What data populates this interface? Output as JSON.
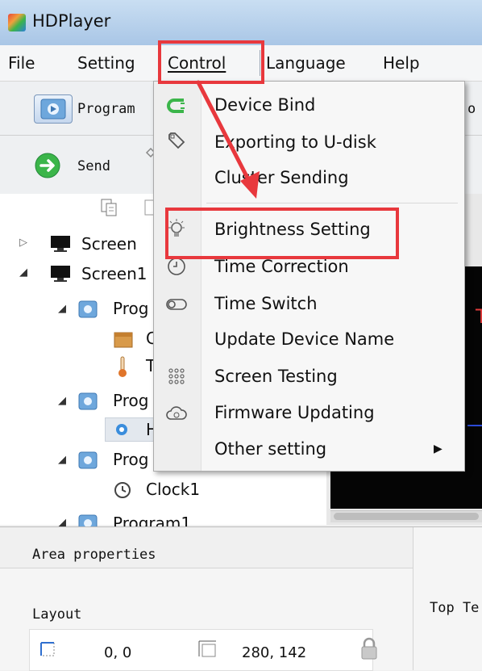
{
  "window": {
    "title": "HDPlayer"
  },
  "menubar": {
    "file": "File",
    "setting": "Setting",
    "control": "Control",
    "language": "Language",
    "help": "Help"
  },
  "toolbar": {
    "program": "Program",
    "send": "Send",
    "partial_right": "o"
  },
  "tree": {
    "screen": "Screen",
    "screen1": "Screen1",
    "prog_a": "Prog",
    "child_a1": "C",
    "child_a2": "T",
    "prog_b": "Prog",
    "child_b1": "H",
    "prog_c": "Prog",
    "clock": "Clock1",
    "program1": "Program1"
  },
  "preview": {
    "text_partial": "T"
  },
  "properties": {
    "header": "Area properties",
    "layout_label": "Layout",
    "position": "0, 0",
    "size": "280, 142",
    "right_label": "Top Te"
  },
  "control_menu": {
    "items": [
      {
        "label": "Device Bind",
        "icon": "magnet-icon"
      },
      {
        "label": "Exporting to U-disk",
        "icon": "usb-icon"
      },
      {
        "label": "Cluster Sending",
        "icon": "none"
      },
      {
        "label": "Brightness Setting",
        "icon": "bulb-icon"
      },
      {
        "label": "Time Correction",
        "icon": "clock-icon"
      },
      {
        "label": "Time Switch",
        "icon": "toggle-icon"
      },
      {
        "label": "Update Device Name",
        "icon": "none"
      },
      {
        "label": "Screen Testing",
        "icon": "grid-dots-icon"
      },
      {
        "label": "Firmware Updating",
        "icon": "cloud-icon"
      },
      {
        "label": "Other setting",
        "icon": "submenu-arrow-icon"
      }
    ]
  },
  "colors": {
    "annotation_red": "#e8383d",
    "titlebar": "#b9d3ee",
    "device_bind_green": "#3bb54a"
  }
}
